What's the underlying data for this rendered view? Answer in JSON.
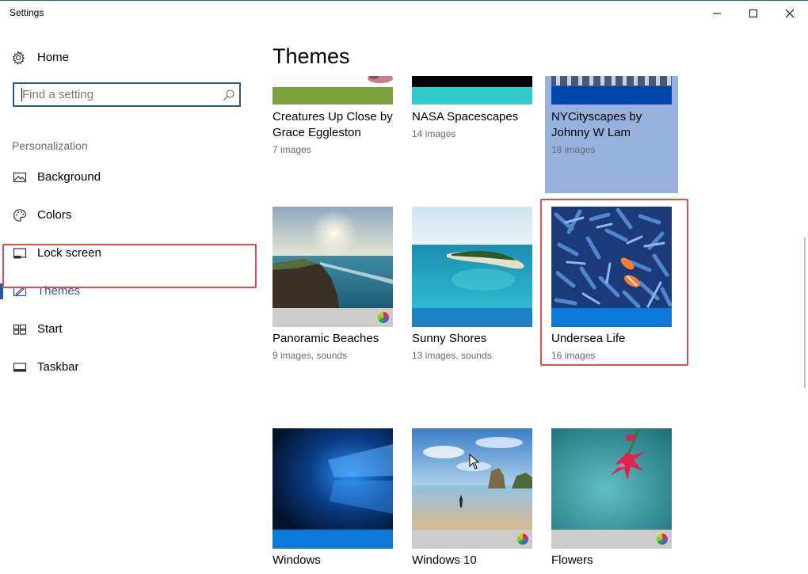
{
  "window": {
    "title": "Settings",
    "controls": {
      "minimize": "minimize-icon",
      "maximize": "maximize-icon",
      "close": "close-icon"
    }
  },
  "sidebar": {
    "home_label": "Home",
    "search": {
      "placeholder": "Find a setting",
      "value": ""
    },
    "section_label": "Personalization",
    "items": [
      {
        "label": "Background",
        "icon": "picture-icon"
      },
      {
        "label": "Colors",
        "icon": "palette-icon"
      },
      {
        "label": "Lock screen",
        "icon": "lock-screen-icon"
      },
      {
        "label": "Themes",
        "icon": "themes-icon",
        "selected": true
      },
      {
        "label": "Start",
        "icon": "start-icon"
      },
      {
        "label": "Taskbar",
        "icon": "taskbar-icon"
      }
    ]
  },
  "main": {
    "title": "Themes",
    "themes": [
      {
        "name": "Creatures Up Close by Grace Eggleston",
        "count": "7 images",
        "accent": "#7ba23f"
      },
      {
        "name": "NASA Spacescapes",
        "count": "14 images",
        "accent": "#33cccc"
      },
      {
        "name": "NYCityscapes by Johnny W Lam",
        "count": "18 images",
        "accent": "#0046ad",
        "selected": true
      },
      {
        "name": "Panoramic Beaches",
        "count": "9 images, sounds",
        "accent": "#cccccc",
        "multicolor": true
      },
      {
        "name": "Sunny Shores",
        "count": "13 images, sounds",
        "accent": "#1c82c4"
      },
      {
        "name": "Undersea Life",
        "count": "16 images",
        "accent": "#0a78d7",
        "highlighted": true
      },
      {
        "name": "Windows",
        "count": "",
        "accent": "#0a78d7"
      },
      {
        "name": "Windows 10",
        "count": "",
        "accent": "#cccccc",
        "multicolor": true
      },
      {
        "name": "Flowers",
        "count": "",
        "accent": "#cccccc",
        "multicolor": true
      }
    ]
  },
  "colors": {
    "accent": "#2b579a",
    "highlight": "#e04b4b",
    "selected_tile": "#97b2de"
  }
}
